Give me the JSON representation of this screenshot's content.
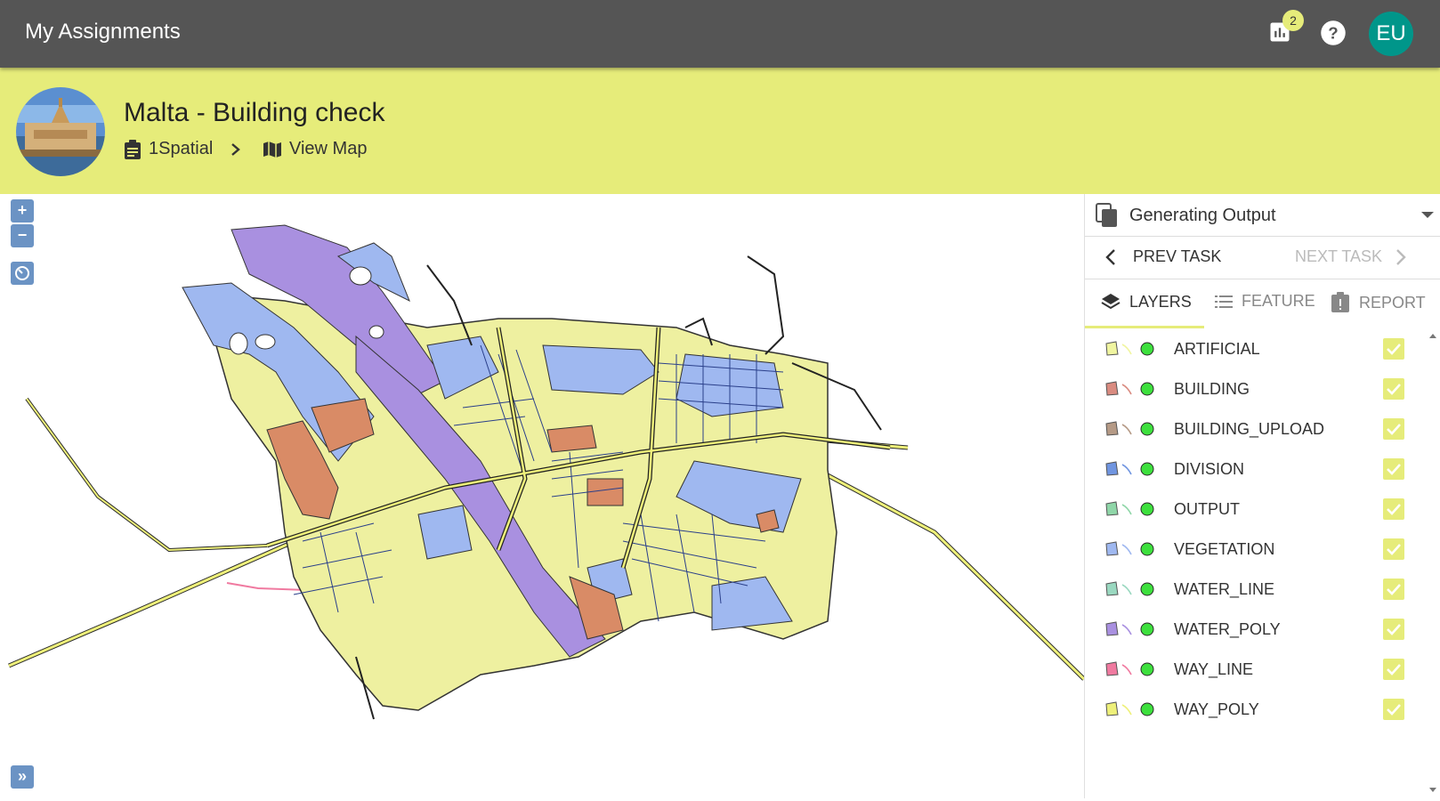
{
  "app": {
    "title": "My Assignments",
    "stats_badge": "2",
    "user_initials": "EU"
  },
  "project": {
    "title": "Malta - Building check",
    "breadcrumb": {
      "org": "1Spatial",
      "map_link": "View Map"
    }
  },
  "map": {
    "zoom_in": "+",
    "zoom_out": "−",
    "expand": "»"
  },
  "panel": {
    "status": "Generating Output",
    "prev_task": "PREV TASK",
    "next_task": "NEXT TASK",
    "tabs": [
      {
        "label": "LAYERS",
        "icon": "layers-icon",
        "active": true
      },
      {
        "label": "FEATURE",
        "icon": "list-icon",
        "active": false
      },
      {
        "label": "REPORT",
        "icon": "report-icon",
        "active": false
      }
    ],
    "layers": [
      {
        "name": "ARTIFICIAL",
        "color": "#f0f5a0",
        "checked": true
      },
      {
        "name": "BUILDING",
        "color": "#d98b80",
        "checked": true
      },
      {
        "name": "BUILDING_UPLOAD",
        "color": "#b59a86",
        "checked": true
      },
      {
        "name": "DIVISION",
        "color": "#7095e0",
        "checked": true
      },
      {
        "name": "OUTPUT",
        "color": "#8fd6a8",
        "checked": true
      },
      {
        "name": "VEGETATION",
        "color": "#9fb8f0",
        "checked": true
      },
      {
        "name": "WATER_LINE",
        "color": "#9ad8c0",
        "checked": true
      },
      {
        "name": "WATER_POLY",
        "color": "#a990e0",
        "checked": true
      },
      {
        "name": "WAY_LINE",
        "color": "#f07aa0",
        "checked": true
      },
      {
        "name": "WAY_POLY",
        "color": "#eef07a",
        "checked": true
      }
    ]
  },
  "colors": {
    "accent": "#e6ec7a",
    "topbar": "#555555",
    "avatar": "#00968a"
  }
}
